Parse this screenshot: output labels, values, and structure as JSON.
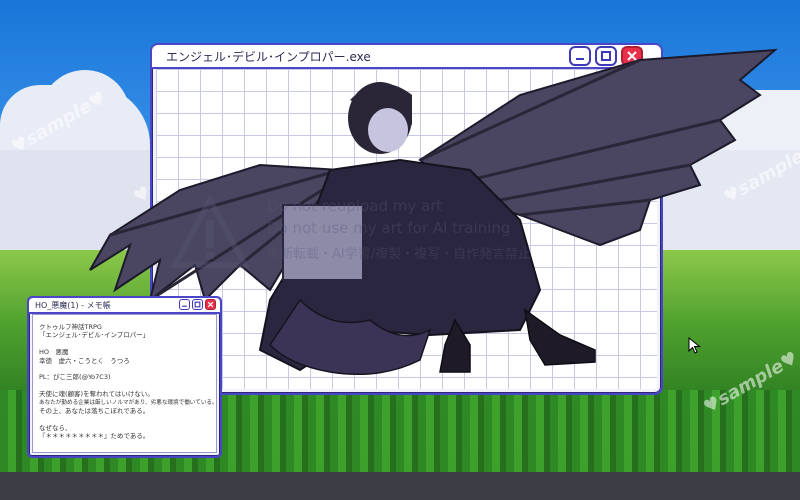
{
  "main_window": {
    "title": "エンジェル･デビル･インプロパー.exe"
  },
  "memo_window": {
    "title": "HO_悪魔(1) - メモ帳",
    "lines": [
      "クトゥルフ神話TRPG",
      "「エンジェル･デビル･インプロパー」",
      "",
      "HO　悪魔",
      "幸徳　虚六・こうとく　うつろ",
      "",
      "PL：ぴこ三郎(@Yo7C3)",
      "",
      "天使に魂(顧客)を奪われてはいけない。",
      "あなたが勤める企業は厳しいノルマがあり、劣悪な環境で働いている。",
      "その上、あなたは落ちこぼれである。",
      "",
      "なぜなら、",
      "『＊＊＊＊＊＊＊＊＊』ためである。"
    ]
  },
  "watermark": {
    "line1": "Do not reupload my art",
    "line2": "Do not use my art for AI training",
    "line3": "無断転載・AI学習/複製・複写・自作発言禁止"
  },
  "sample_text": "♥sample♥",
  "colors": {
    "window_border": "#4b46c8",
    "close_button": "#e8304a",
    "sky": "#3c93ea",
    "grass": "#3ea32c",
    "taskbar": "#3d3d45"
  },
  "icons": [
    "minimize-icon",
    "maximize-icon",
    "close-icon",
    "mouse-cursor-icon",
    "warning-triangle-icon"
  ]
}
